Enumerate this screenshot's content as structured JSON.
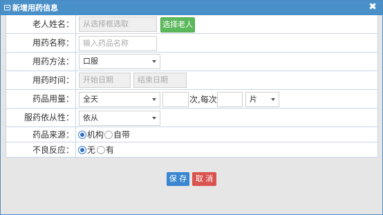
{
  "dialog": {
    "title": "新增用药信息",
    "close_glyph": "✖"
  },
  "form": {
    "elder_name": {
      "label": "老人姓名：",
      "placeholder": "从选择框选取",
      "select_button": "选择老人"
    },
    "drug_name": {
      "label": "用药名称：",
      "placeholder": "输入药品名称"
    },
    "usage_method": {
      "label": "用药方法：",
      "value": "口服"
    },
    "usage_time": {
      "label": "用药时间：",
      "start_placeholder": "开始日期",
      "end_placeholder": "结束日期"
    },
    "dosage": {
      "label": "药品用量：",
      "frequency": "全天",
      "times_text": "次,每次",
      "unit": "片"
    },
    "compliance": {
      "label": "服药依从性：",
      "value": "依从"
    },
    "source": {
      "label": "药品来源：",
      "options": [
        "机构",
        "自带"
      ],
      "selected": "机构"
    },
    "adverse_reaction": {
      "label": "不良反应：",
      "options": [
        "无",
        "有"
      ],
      "selected": "无"
    }
  },
  "actions": {
    "save_label": "保 存",
    "cancel_label": "取 消"
  }
}
